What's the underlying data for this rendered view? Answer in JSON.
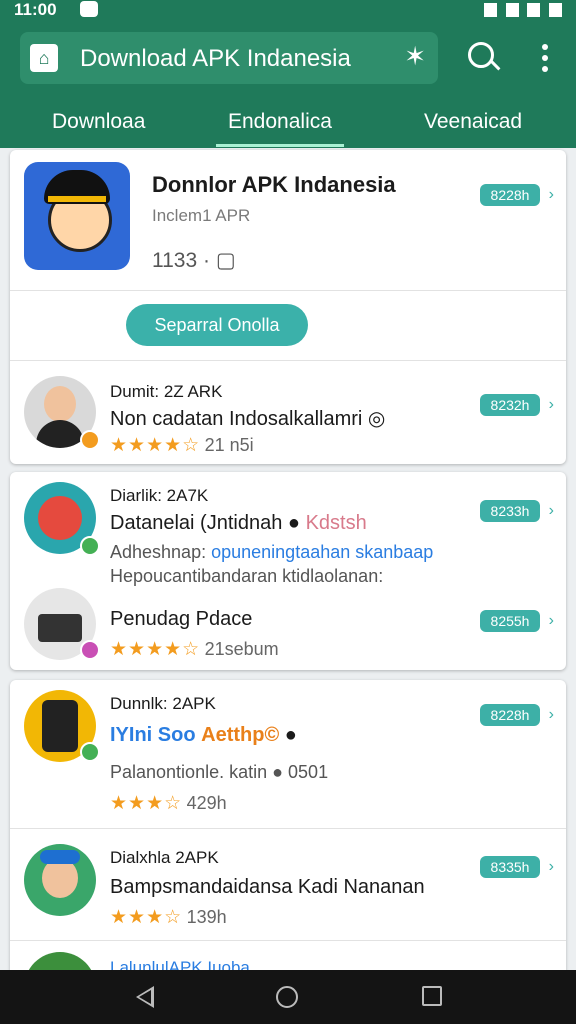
{
  "status_bar": {
    "time": "11:00"
  },
  "app_bar": {
    "title": "Download APK Indanesia",
    "search_icon": "search-icon",
    "menu_icon": "more-vert-icon"
  },
  "tabs": [
    {
      "label": "Downloaa"
    },
    {
      "label": "Endonalica"
    },
    {
      "label": "Veenaicad"
    }
  ],
  "featured": {
    "title": "Donnlor APK Indanesia",
    "subtitle": "Inclem1 APR",
    "meta": "1133 ·",
    "pill": "8228h",
    "action": "Separral Onolla"
  },
  "items": [
    {
      "line1": "Dumit: 2Z ARK",
      "line2": "Non cadatan Indosalkallamri ◎",
      "stars": "★★★★☆",
      "rating": "21 n5i",
      "pill": "8232h"
    },
    {
      "line1": "Diarlik: 2A7K",
      "line2": "Datanelai (Jntidnah",
      "line2b": "Kdstsh",
      "line3": "Adheshnap:",
      "line3b": "opuneningtaahan skanbaap",
      "line4": "Hepoucantibandaran ktidlaolanan:",
      "pill": "8233h"
    },
    {
      "line1": "Penudag Pdace",
      "stars": "★★★★☆",
      "rating": "21sebum",
      "pill": "8255h"
    },
    {
      "line1": "Dunnlk: 2APK",
      "line2a": "IYIni Soo",
      "line2b": "Aetthp©",
      "line3": "Palanontionle. katin",
      "line3b": "0501",
      "stars": "★★★☆",
      "rating": "429h",
      "pill": "8228h"
    },
    {
      "line1": "Dialxhla 2APK",
      "line2": "Bampsmandaidansa Kadi Nananan",
      "stars": "★★★☆",
      "rating": "139h",
      "pill": "8335h"
    },
    {
      "line1": "LalunlulAPK Iuoba"
    }
  ]
}
